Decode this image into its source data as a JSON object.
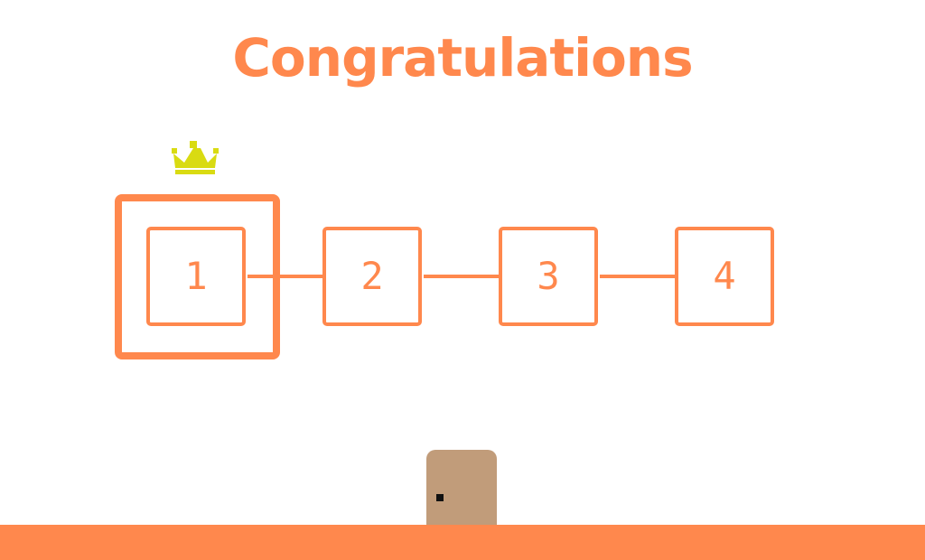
{
  "title": "Congratulations",
  "levels": [
    {
      "label": "1",
      "completed": true,
      "selected": true
    },
    {
      "label": "2",
      "completed": false,
      "selected": false
    },
    {
      "label": "3",
      "completed": false,
      "selected": false
    },
    {
      "label": "4",
      "completed": false,
      "selected": false
    }
  ],
  "icons": {
    "crown": "crown-icon",
    "door": "door-icon"
  },
  "colors": {
    "accent": "#FF884D",
    "crown": "#D9DB12",
    "door": "#C19C7A",
    "background": "#FFFFFF",
    "door_knob": "#111111"
  }
}
